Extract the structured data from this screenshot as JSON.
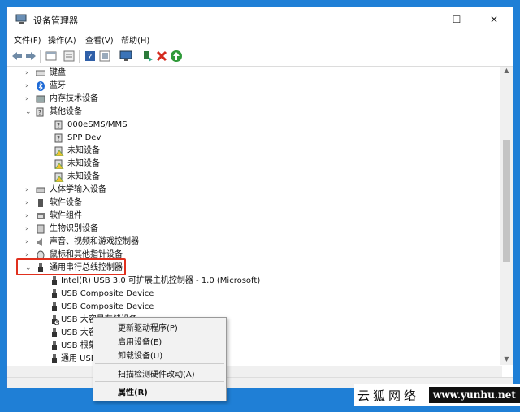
{
  "window": {
    "title": "设备管理器",
    "min_glyph": "—",
    "max_glyph": "☐",
    "close_glyph": "✕"
  },
  "menubar": {
    "items": [
      "文件(F)",
      "操作(A)",
      "查看(V)",
      "帮助(H)"
    ]
  },
  "tree": {
    "categories_top": [
      "键盘",
      "蓝牙",
      "内存技术设备",
      "其他设备"
    ],
    "other_devices": [
      "000eSMS/MMS",
      "SPP Dev",
      "未知设备",
      "未知设备",
      "未知设备"
    ],
    "categories_mid": [
      "人体学输入设备",
      "软件设备",
      "软件组件",
      "生物识别设备",
      "声音、视频和游戏控制器",
      "鼠标和其他指针设备",
      "通用串行总线控制器"
    ],
    "usb_devices": [
      "Intel(R) USB 3.0 可扩展主机控制器 - 1.0 (Microsoft)",
      "USB Composite Device",
      "USB Composite Device",
      "USB 大容量存储设备",
      "USB 大容",
      "USB 根集",
      "通用 USB"
    ]
  },
  "context_menu": {
    "items": [
      "更新驱动程序(P)",
      "启用设备(E)",
      "卸载设备(U)",
      "扫描检测硬件改动(A)",
      "属性(R)"
    ]
  },
  "watermark": {
    "cn": "云狐网络",
    "url": "www.yunhu.net"
  },
  "colors": {
    "accent_red": "#e0301e",
    "background": "#1f7fd6"
  }
}
